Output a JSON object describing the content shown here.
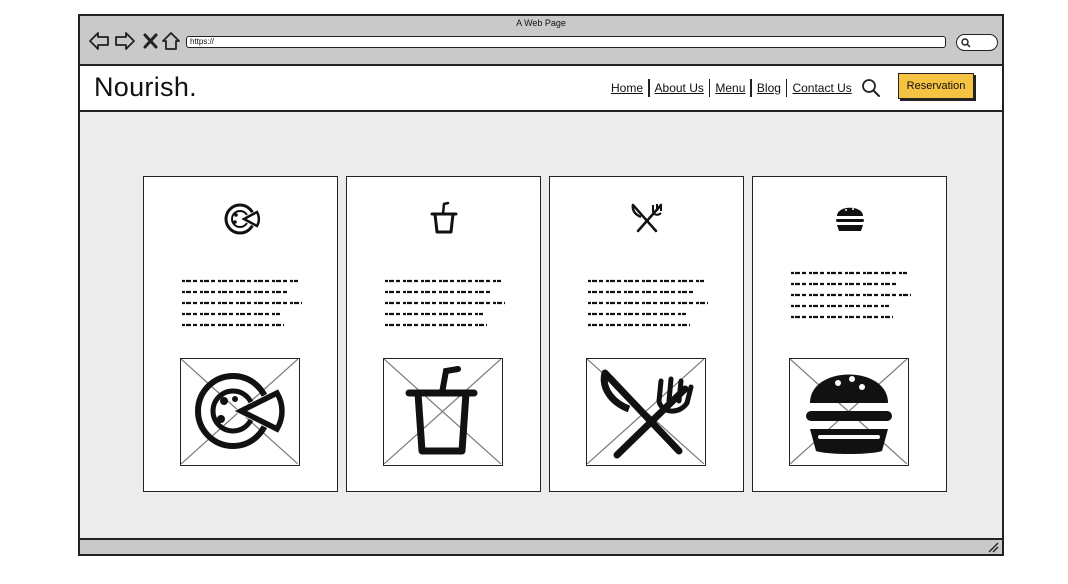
{
  "window": {
    "title": "A Web Page",
    "url": "https://"
  },
  "site": {
    "brand": "Nourish.",
    "nav": [
      "Home",
      "About Us",
      "Menu",
      "Blog",
      "Contact Us"
    ],
    "reservation_label": "Reservation"
  },
  "cards": [
    {
      "icon": "pizza-icon"
    },
    {
      "icon": "drink-cup-icon"
    },
    {
      "icon": "fork-knife-icon"
    },
    {
      "icon": "burger-icon"
    }
  ],
  "colors": {
    "accent": "#f5c242",
    "page_bg": "#ececec",
    "chrome": "#c9c9c9"
  }
}
